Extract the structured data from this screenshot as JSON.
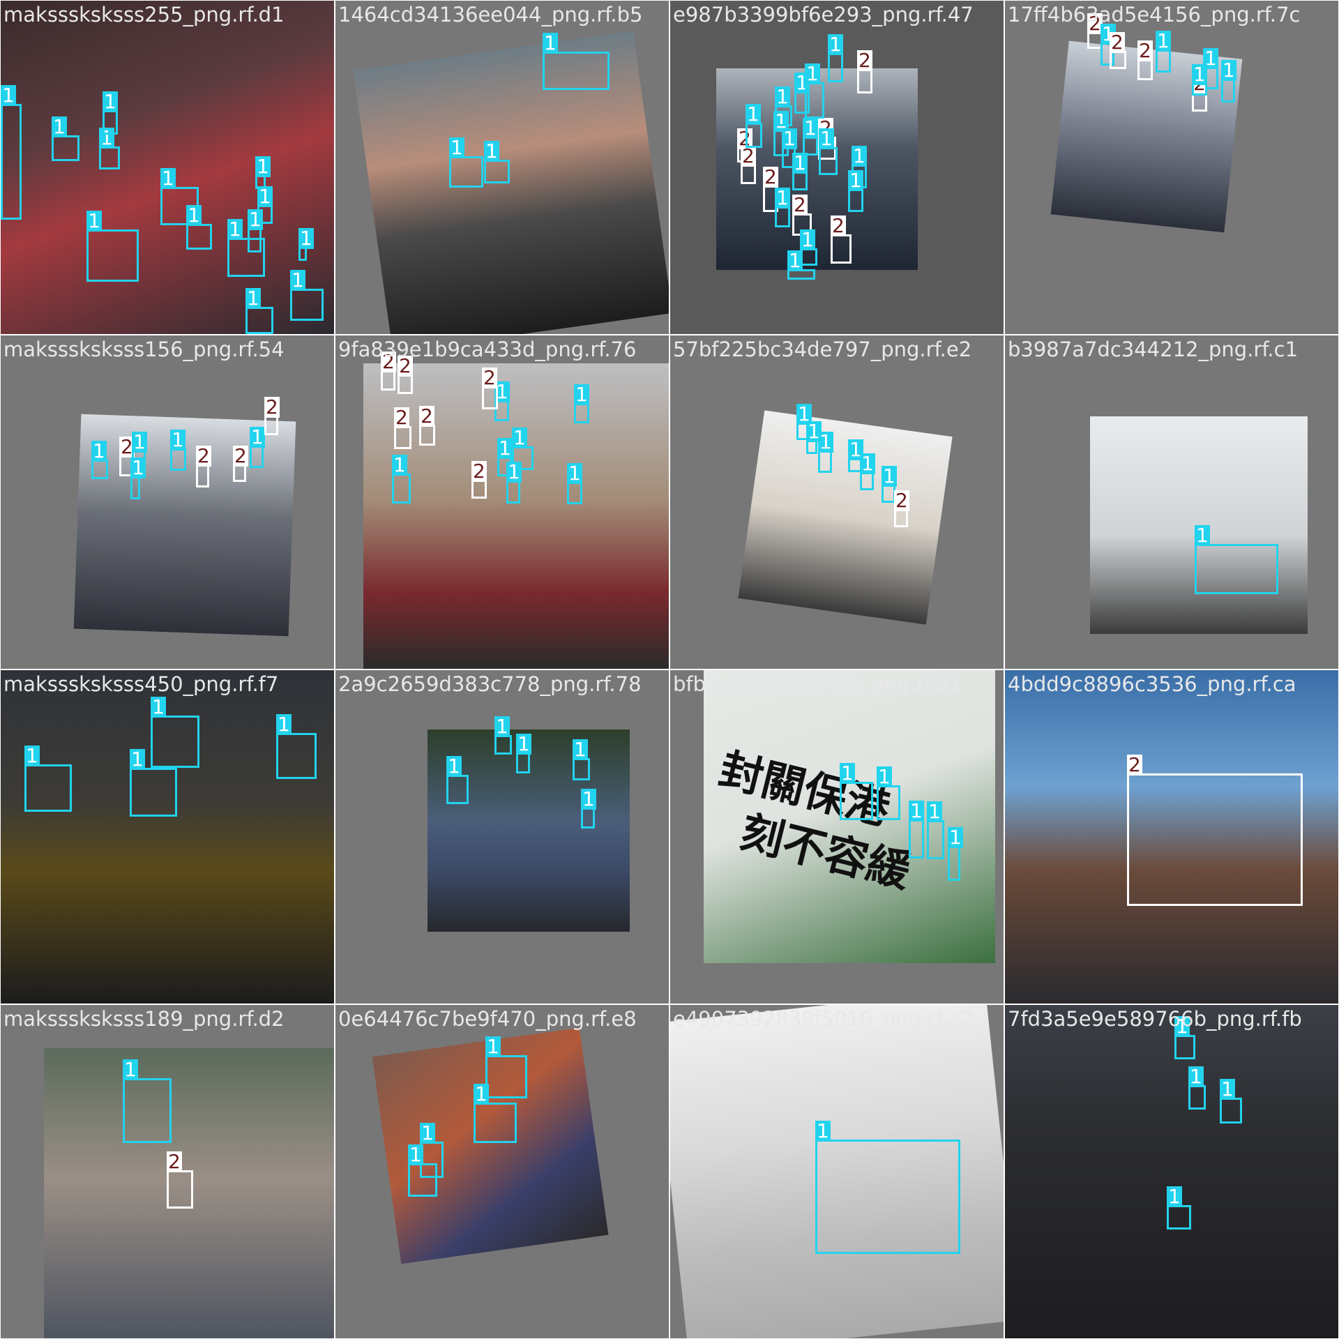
{
  "colors": {
    "class_1_box": "#22d3ee",
    "class_2_box": "#ffffff",
    "class_2_label_text": "#6b1b1b",
    "title_text": "#e8e8e8",
    "tile_padding_gray": "#777777"
  },
  "tiles": [
    {
      "title": "maksssksksss255_png.rf.d1",
      "scene": "scene-a",
      "boxes": [
        {
          "label": "1"
        },
        {
          "label": "1"
        },
        {
          "label": "1"
        },
        {
          "label": "1"
        },
        {
          "label": "1"
        },
        {
          "label": "1"
        },
        {
          "label": "1"
        },
        {
          "label": "1"
        },
        {
          "label": "1"
        },
        {
          "label": "1"
        },
        {
          "label": "1"
        },
        {
          "label": "1"
        },
        {
          "label": "1"
        },
        {
          "label": "1"
        }
      ]
    },
    {
      "title": "1464cd34136ee044_png.rf.b5",
      "scene": "scene-b",
      "boxes": [
        {
          "label": "1"
        },
        {
          "label": "1"
        },
        {
          "label": "1"
        }
      ]
    },
    {
      "title": "e987b3399bf6e293_png.rf.47",
      "scene": "scene-c",
      "boxes": [
        {
          "label": "2"
        },
        {
          "label": "2"
        },
        {
          "label": "1"
        },
        {
          "label": "1"
        },
        {
          "label": "2"
        },
        {
          "label": "1"
        },
        {
          "label": "1"
        },
        {
          "label": "1"
        },
        {
          "label": "2"
        },
        {
          "label": "1"
        },
        {
          "label": "1"
        },
        {
          "label": "1"
        },
        {
          "label": "1"
        },
        {
          "label": "1"
        },
        {
          "label": "2"
        },
        {
          "label": "1"
        },
        {
          "label": "1"
        },
        {
          "label": "1"
        },
        {
          "label": "2"
        },
        {
          "label": "2"
        },
        {
          "label": "1"
        },
        {
          "label": "1"
        }
      ]
    },
    {
      "title": "17ff4b63ad5e4156_png.rf.7c",
      "scene": "scene-d",
      "boxes": [
        {
          "label": "2"
        },
        {
          "label": "1"
        },
        {
          "label": "2"
        },
        {
          "label": "2"
        },
        {
          "label": "1"
        },
        {
          "label": "1"
        },
        {
          "label": "2"
        },
        {
          "label": "1"
        },
        {
          "label": "1"
        }
      ]
    },
    {
      "title": "maksssksksss156_png.rf.54",
      "scene": "scene-e",
      "boxes": [
        {
          "label": "1"
        },
        {
          "label": "2"
        },
        {
          "label": "1"
        },
        {
          "label": "1"
        },
        {
          "label": "1"
        },
        {
          "label": "2"
        },
        {
          "label": "2"
        },
        {
          "label": "1"
        },
        {
          "label": "2"
        }
      ]
    },
    {
      "title": "9fa839e1b9ca433d_png.rf.76",
      "scene": "scene-f",
      "boxes": [
        {
          "label": "2"
        },
        {
          "label": "2"
        },
        {
          "label": "2"
        },
        {
          "label": "2"
        },
        {
          "label": "1"
        },
        {
          "label": "1"
        },
        {
          "label": "2"
        },
        {
          "label": "1"
        },
        {
          "label": "1"
        },
        {
          "label": "2"
        },
        {
          "label": "1"
        },
        {
          "label": "1"
        },
        {
          "label": "1"
        }
      ]
    },
    {
      "title": "57bf225bc34de797_png.rf.e2",
      "scene": "scene-g",
      "boxes": [
        {
          "label": "1"
        },
        {
          "label": "1"
        },
        {
          "label": "1"
        },
        {
          "label": "1"
        },
        {
          "label": "1"
        },
        {
          "label": "1"
        },
        {
          "label": "2"
        }
      ]
    },
    {
      "title": "b3987a7dc344212_png.rf.c1",
      "scene": "scene-h",
      "boxes": [
        {
          "label": "1"
        }
      ]
    },
    {
      "title": "maksssksksss450_png.rf.f7",
      "scene": "scene-i",
      "boxes": [
        {
          "label": "1"
        },
        {
          "label": "1"
        },
        {
          "label": "1"
        },
        {
          "label": "1"
        }
      ]
    },
    {
      "title": "2a9c2659d383c778_png.rf.78",
      "scene": "scene-j",
      "boxes": [
        {
          "label": "1"
        },
        {
          "label": "1"
        },
        {
          "label": "1"
        },
        {
          "label": "1"
        },
        {
          "label": "1"
        }
      ]
    },
    {
      "title": "bfb3a3b3f1557f85_png.rf.21",
      "scene": "scene-k",
      "sign_lines": [
        "封關保港",
        "刻不容緩"
      ],
      "boxes": [
        {
          "label": "1"
        },
        {
          "label": "1"
        },
        {
          "label": "1"
        },
        {
          "label": "1"
        },
        {
          "label": "1"
        }
      ]
    },
    {
      "title": "4bdd9c8896c3536_png.rf.ca",
      "scene": "scene-l",
      "boxes": [
        {
          "label": "2"
        }
      ]
    },
    {
      "title": "maksssksksss189_png.rf.d2",
      "scene": "scene-m",
      "boxes": [
        {
          "label": "1"
        },
        {
          "label": "2"
        }
      ]
    },
    {
      "title": "0e64476c7be9f470_png.rf.e8",
      "scene": "scene-n",
      "boxes": [
        {
          "label": "1"
        },
        {
          "label": "1"
        },
        {
          "label": "1"
        },
        {
          "label": "1"
        }
      ]
    },
    {
      "title": "e4907392838f5010_png.rf.a2",
      "scene": "scene-o",
      "boxes": [
        {
          "label": "1"
        }
      ]
    },
    {
      "title": "7fd3a5e9e589766b_png.rf.fb",
      "scene": "scene-p",
      "boxes": [
        {
          "label": "1"
        },
        {
          "label": "1"
        },
        {
          "label": "1"
        },
        {
          "label": "1"
        }
      ]
    }
  ]
}
